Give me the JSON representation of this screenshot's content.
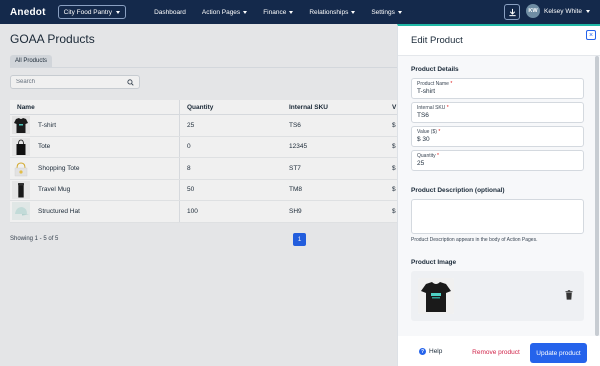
{
  "nav": {
    "logo": "Anedot",
    "org": "City Food Pantry",
    "items": [
      {
        "label": "Dashboard",
        "dropdown": false
      },
      {
        "label": "Action Pages",
        "dropdown": true
      },
      {
        "label": "Finance",
        "dropdown": true
      },
      {
        "label": "Relationships",
        "dropdown": true
      },
      {
        "label": "Settings",
        "dropdown": true
      }
    ],
    "user_initials": "KW",
    "user_name": "Kelsey White"
  },
  "page": {
    "title": "GOAA Products",
    "tab": "All Products",
    "search_placeholder": "Search",
    "columns": {
      "name": "Name",
      "qty": "Quantity",
      "sku": "Internal SKU",
      "value": "V"
    },
    "rows": [
      {
        "name": "T-shirt",
        "qty": "25",
        "sku": "TS6",
        "value": "$",
        "thumb": "tshirt"
      },
      {
        "name": "Tote",
        "qty": "0",
        "sku": "12345",
        "value": "$",
        "thumb": "tote"
      },
      {
        "name": "Shopping Tote",
        "qty": "8",
        "sku": "ST7",
        "value": "$",
        "thumb": "shopping-tote"
      },
      {
        "name": "Travel Mug",
        "qty": "50",
        "sku": "TM8",
        "value": "$",
        "thumb": "mug"
      },
      {
        "name": "Structured Hat",
        "qty": "100",
        "sku": "SH9",
        "value": "$",
        "thumb": "hat"
      }
    ],
    "showing": "Showing 1 - 5 of 5",
    "page_number": "1"
  },
  "panel": {
    "title": "Edit Product",
    "close": "×",
    "details_title": "Product Details",
    "fields": [
      {
        "label": "Product Name",
        "value": "T-shirt"
      },
      {
        "label": "Internal SKU",
        "value": "TS6"
      },
      {
        "label": "Value ($)",
        "value": "$ 30"
      },
      {
        "label": "Quantity",
        "value": "25"
      }
    ],
    "required_mark": "*",
    "description_title": "Product Description (optional)",
    "description_help": "Product Description appears in the body of Action Pages.",
    "image_title": "Product Image",
    "help": "Help",
    "remove": "Remove product",
    "update": "Update product"
  },
  "colors": {
    "nav_bg": "#14294b",
    "accent": "#2563eb",
    "danger": "#d1244a",
    "panel_top": "#20b8a6"
  }
}
